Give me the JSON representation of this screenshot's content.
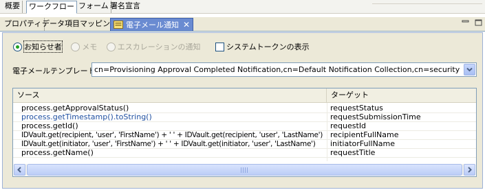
{
  "top_tabs": [
    {
      "label": "概要"
    },
    {
      "label": "ワークフロー"
    },
    {
      "label": "フォーム"
    },
    {
      "label": "署名宣言"
    }
  ],
  "view_tabs": [
    {
      "label": "プロパティ"
    },
    {
      "label": "データ項目マッピング"
    },
    {
      "label": "電子メール通知",
      "icon": "email-notification-icon"
    }
  ],
  "notification_type": {
    "options": [
      {
        "label": "お知らせ者",
        "checked": true,
        "enabled": true
      },
      {
        "label": "メモ",
        "checked": false,
        "enabled": false
      },
      {
        "label": "エスカレーションの通知",
        "checked": false,
        "enabled": false
      }
    ]
  },
  "system_token": {
    "label": "システムトークンの表示",
    "checked": false
  },
  "template": {
    "label": "電子メールテンプレート",
    "value": "cn=Provisioning Approval Completed Notification,cn=Default Notification Collection,cn=security"
  },
  "mapping_table": {
    "columns": [
      "ソース",
      "ターゲット"
    ],
    "rows": [
      {
        "source": "process.getApprovalStatus()",
        "target": "requestStatus"
      },
      {
        "source": "process.getTimestamp().toString()",
        "target": "requestSubmissionTime"
      },
      {
        "source": "process.getId()",
        "target": "requestId"
      },
      {
        "source": "IDVault.get(recipient, 'user', 'FirstName') + ' ' + IDVault.get(recipient, 'user', 'LastName')",
        "target": "recipientFullName"
      },
      {
        "source": "IDVault.get(initiator, 'user', 'FirstName') + ' ' + IDVault.get(initiator, 'user', 'LastName')",
        "target": "initiatorFullName"
      },
      {
        "source": "process.getName()",
        "target": "requestTitle"
      }
    ]
  },
  "colors": {
    "active_tab": "#6a8bd1",
    "panel_bg": "#ece9d8",
    "link_text": "#1f4fa0",
    "radio_checked": "#21a121"
  }
}
